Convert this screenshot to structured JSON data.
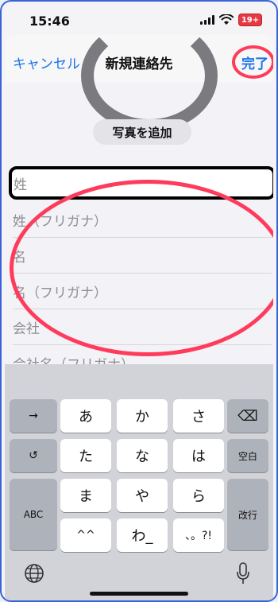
{
  "status_bar": {
    "time": "15:46",
    "battery": "19+"
  },
  "nav": {
    "cancel": "キャンセル",
    "title": "新規連絡先",
    "done": "完了"
  },
  "photo": {
    "add_label": "写真を追加"
  },
  "form": {
    "fields": [
      {
        "label": "姓",
        "active": true
      },
      {
        "label": "姓（フリガナ）"
      },
      {
        "label": "名"
      },
      {
        "label": "名（フリガナ）"
      },
      {
        "label": "会社"
      },
      {
        "label": "会社名（フリガナ）"
      }
    ]
  },
  "keyboard": {
    "left": {
      "arrow": "→",
      "undo": "↺",
      "abc": "ABC"
    },
    "rows": [
      [
        "あ",
        "か",
        "さ"
      ],
      [
        "た",
        "な",
        "は"
      ],
      [
        "ま",
        "や",
        "ら"
      ],
      [
        "^^",
        "わ_",
        "、。?!"
      ]
    ],
    "right": {
      "backspace": "⌫",
      "space": "空白",
      "return": "改行"
    }
  },
  "annotations": {
    "color": "#ff3b5c",
    "active_field_border": "#000000"
  }
}
